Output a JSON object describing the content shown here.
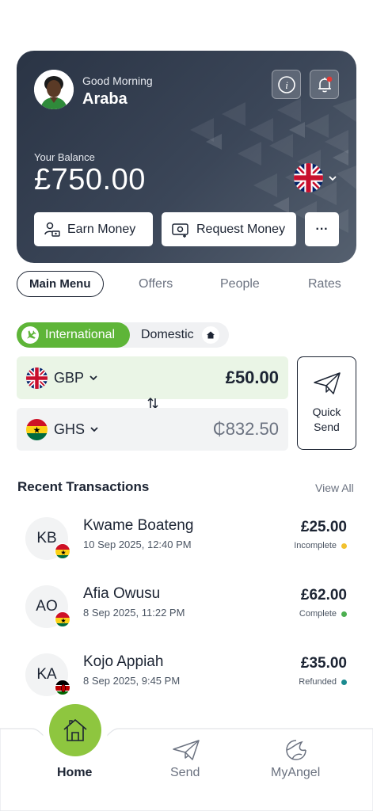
{
  "colors": {
    "card_gradient_start": "#2a3445",
    "card_gradient_end": "#55606f",
    "accent_green": "#5eb538",
    "home_green": "#8ec63f",
    "status_incomplete": "#f2c12e",
    "status_complete": "#4caf50",
    "status_refunded": "#1a8a8f"
  },
  "header": {
    "greeting": "Good Morning",
    "user_name": "Araba",
    "info_icon": "info-icon",
    "notification_icon": "bell-icon"
  },
  "balance": {
    "label": "Your Balance",
    "amount": "£750.00",
    "currency_flag": "uk-flag-icon"
  },
  "actions": {
    "earn": "Earn Money",
    "request": "Request Money",
    "more": "···"
  },
  "tabs": [
    {
      "label": "Main Menu",
      "active": true
    },
    {
      "label": "Offers",
      "active": false
    },
    {
      "label": "People",
      "active": false
    },
    {
      "label": "Rates",
      "active": false
    }
  ],
  "transfer_type": {
    "international": "International",
    "domestic": "Domestic",
    "selected": "International"
  },
  "converter": {
    "from_currency": "GBP",
    "from_amount": "£50.00",
    "to_currency": "GHS",
    "to_amount": "₵832.50",
    "quick_send_line1": "Quick",
    "quick_send_line2": "Send"
  },
  "transactions": {
    "title": "Recent Transactions",
    "view_all": "View All",
    "items": [
      {
        "initials": "KB",
        "name": "Kwame Boateng",
        "date": "10 Sep 2025, 12:40 PM",
        "amount": "£25.00",
        "status": "Incomplete",
        "flag": "ghana"
      },
      {
        "initials": "AO",
        "name": "Afia Owusu",
        "date": "8 Sep 2025, 11:22 PM",
        "amount": "£62.00",
        "status": "Complete",
        "flag": "ghana"
      },
      {
        "initials": "KA",
        "name": "Kojo Appiah",
        "date": "8 Sep 2025, 9:45 PM",
        "amount": "£35.00",
        "status": "Refunded",
        "flag": "kenya"
      }
    ]
  },
  "nav": {
    "home": "Home",
    "send": "Send",
    "myangel": "MyAngel"
  }
}
